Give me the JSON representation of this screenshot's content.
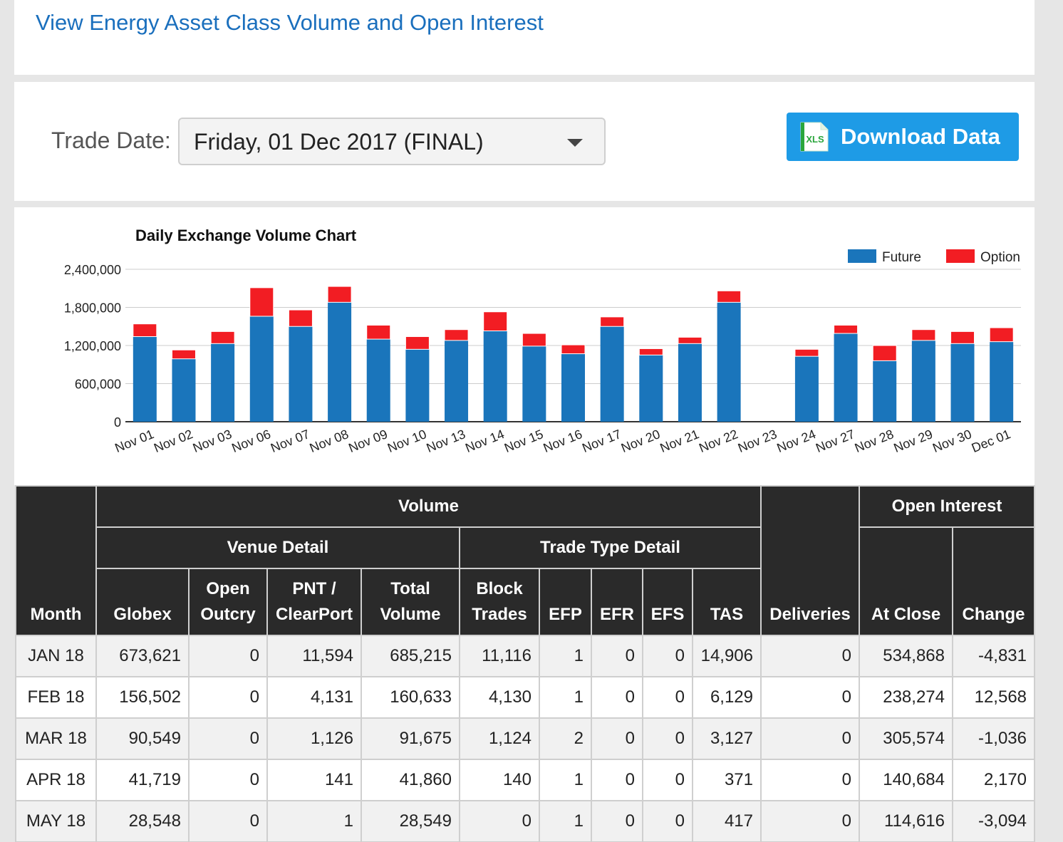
{
  "header": {
    "title": "View Energy Asset Class Volume and Open Interest"
  },
  "controls": {
    "trade_date_label": "Trade Date:",
    "trade_date_value": "Friday, 01 Dec 2017 (FINAL)",
    "download_label": "Download Data",
    "xls_icon_text": "XLS"
  },
  "chart_data": {
    "type": "bar",
    "stacked": true,
    "title": "Daily Exchange Volume Chart",
    "categories": [
      "Nov 01",
      "Nov 02",
      "Nov 03",
      "Nov 06",
      "Nov 07",
      "Nov 08",
      "Nov 09",
      "Nov 10",
      "Nov 13",
      "Nov 14",
      "Nov 15",
      "Nov 16",
      "Nov 17",
      "Nov 20",
      "Nov 21",
      "Nov 22",
      "Nov 23",
      "Nov 24",
      "Nov 27",
      "Nov 28",
      "Nov 29",
      "Nov 30",
      "Dec 01"
    ],
    "series": [
      {
        "name": "Future",
        "color": "#1a75bb",
        "values": [
          1340000,
          990000,
          1230000,
          1660000,
          1500000,
          1880000,
          1300000,
          1140000,
          1280000,
          1430000,
          1190000,
          1070000,
          1500000,
          1050000,
          1230000,
          1880000,
          0,
          1030000,
          1390000,
          960000,
          1280000,
          1230000,
          1260000
        ]
      },
      {
        "name": "Option",
        "color": "#f21d23",
        "values": [
          200000,
          140000,
          190000,
          450000,
          260000,
          250000,
          220000,
          200000,
          170000,
          300000,
          200000,
          140000,
          150000,
          100000,
          100000,
          180000,
          0,
          110000,
          130000,
          240000,
          170000,
          190000,
          220000
        ]
      }
    ],
    "yticks": [
      0,
      600000,
      1200000,
      1800000,
      2400000
    ],
    "ytick_labels": [
      "0",
      "600,000",
      "1,200,000",
      "1,800,000",
      "2,400,000"
    ],
    "ylim": [
      0,
      2400000
    ],
    "legend": "top-right",
    "grid": true
  },
  "table": {
    "group_volume": "Volume",
    "group_venue": "Venue Detail",
    "group_trade_type": "Trade Type Detail",
    "group_oi": "Open Interest",
    "col_month": "Month",
    "col_globex": "Globex",
    "col_open_outcry_1": "Open",
    "col_open_outcry_2": "Outcry",
    "col_pnt_1": "PNT /",
    "col_pnt_2": "ClearPort",
    "col_total_1": "Total",
    "col_total_2": "Volume",
    "col_block_1": "Block",
    "col_block_2": "Trades",
    "col_efp": "EFP",
    "col_efr": "EFR",
    "col_efs": "EFS",
    "col_tas": "TAS",
    "col_deliveries": "Deliveries",
    "col_at_close": "At Close",
    "col_change": "Change",
    "rows": [
      [
        "JAN 18",
        "673,621",
        "0",
        "11,594",
        "685,215",
        "11,116",
        "1",
        "0",
        "0",
        "14,906",
        "0",
        "534,868",
        "-4,831"
      ],
      [
        "FEB 18",
        "156,502",
        "0",
        "4,131",
        "160,633",
        "4,130",
        "1",
        "0",
        "0",
        "6,129",
        "0",
        "238,274",
        "12,568"
      ],
      [
        "MAR 18",
        "90,549",
        "0",
        "1,126",
        "91,675",
        "1,124",
        "2",
        "0",
        "0",
        "3,127",
        "0",
        "305,574",
        "-1,036"
      ],
      [
        "APR 18",
        "41,719",
        "0",
        "141",
        "41,860",
        "140",
        "1",
        "0",
        "0",
        "371",
        "0",
        "140,684",
        "2,170"
      ],
      [
        "MAY 18",
        "28,548",
        "0",
        "1",
        "28,549",
        "0",
        "1",
        "0",
        "0",
        "417",
        "0",
        "114,616",
        "-3,094"
      ]
    ]
  }
}
